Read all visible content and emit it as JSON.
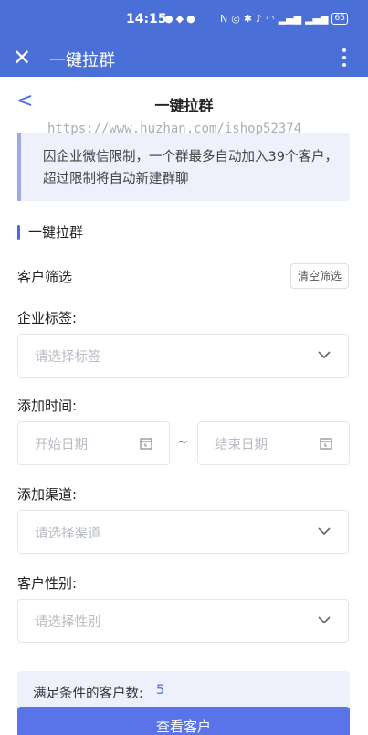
{
  "status_bar": {
    "time": "14:15",
    "left_icons": [
      "chat-icon",
      "location-icon",
      "message-icon"
    ],
    "right_icons": [
      "nfc-icon",
      "alarm-icon",
      "bluetooth-icon",
      "mute-icon",
      "wifi-icon",
      "signal-icon",
      "signal-icon"
    ],
    "battery": "65"
  },
  "app_bar": {
    "title": "一键拉群"
  },
  "nav_bar": {
    "back": "<",
    "title": "一键拉群"
  },
  "watermark": "https://www.huzhan.com/ishop52374",
  "notice": {
    "text": "因企业微信限制，一个群最多自动加入39个客户，超过限制将自动新建群聊"
  },
  "section": {
    "title": "一键拉群"
  },
  "filter": {
    "label": "客户筛选",
    "clear_label": "清空筛选"
  },
  "fields": {
    "tag_label": "企业标签:",
    "tag_placeholder": "请选择标签",
    "time_label": "添加时间:",
    "start_placeholder": "开始日期",
    "separator": "~",
    "end_placeholder": "结束日期",
    "channel_label": "添加渠道:",
    "channel_placeholder": "请选择渠道",
    "gender_label": "客户性别:",
    "gender_placeholder": "请选择性别"
  },
  "footer": {
    "count_label": "满足条件的客户数:",
    "count_value": "5",
    "view_button": "查看客户"
  },
  "colors": {
    "primary": "#4a6fd6",
    "button": "#5b73e8",
    "notice_bg": "#eef0fb"
  }
}
